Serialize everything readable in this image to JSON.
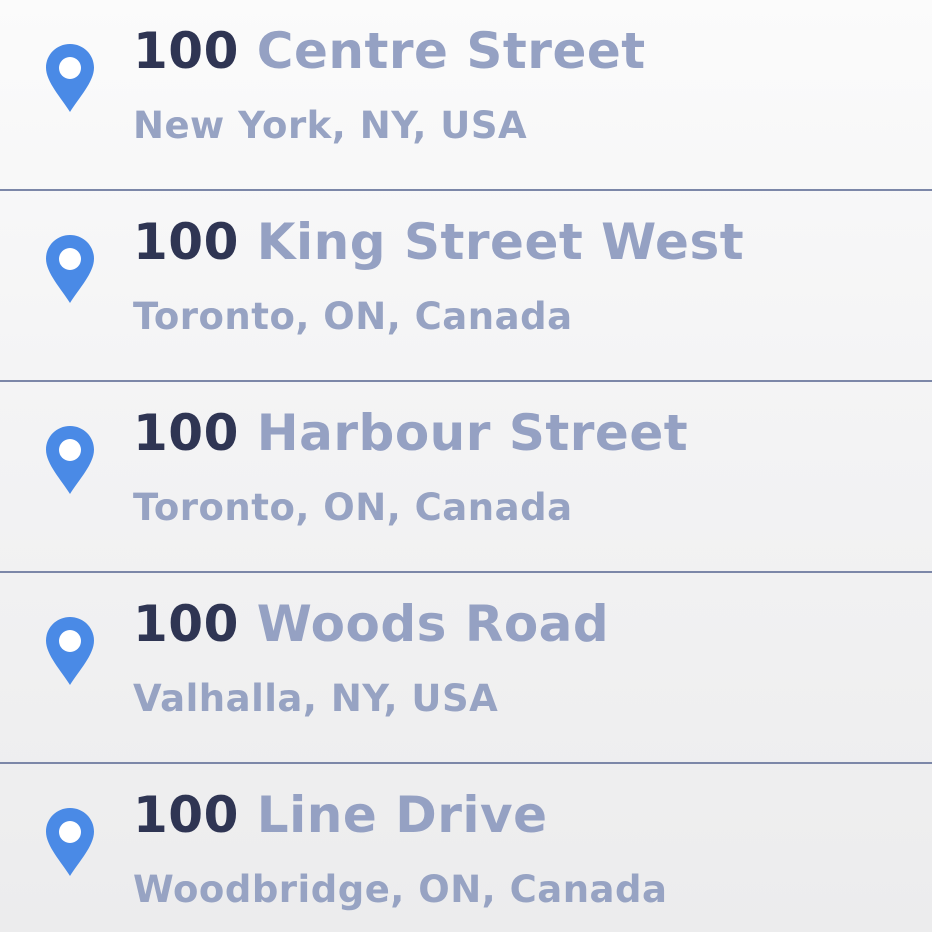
{
  "accent_color": "#4a8ae6",
  "results": [
    {
      "number": "100",
      "street": "Centre Street",
      "location": "New York, NY, USA",
      "icon": "map-pin-icon"
    },
    {
      "number": "100",
      "street": "King Street West",
      "location": "Toronto, ON, Canada",
      "icon": "map-pin-icon"
    },
    {
      "number": "100",
      "street": "Harbour Street",
      "location": "Toronto, ON, Canada",
      "icon": "map-pin-icon"
    },
    {
      "number": "100",
      "street": "Woods Road",
      "location": "Valhalla, NY, USA",
      "icon": "map-pin-icon"
    },
    {
      "number": "100",
      "street": "Line Drive",
      "location": "Woodbridge, ON, Canada",
      "icon": "map-pin-icon"
    }
  ]
}
